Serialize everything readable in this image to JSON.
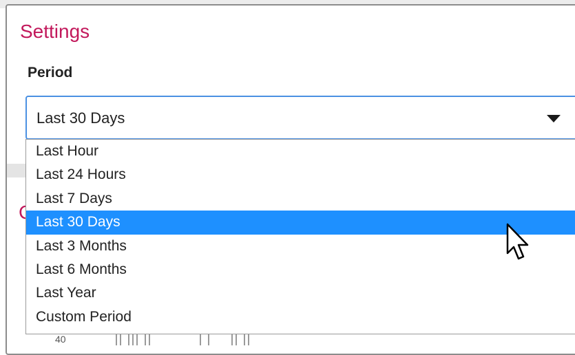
{
  "settings": {
    "title": "Settings",
    "period_label": "Period"
  },
  "period_select": {
    "value": "Last 30 Days",
    "options": [
      {
        "label": "Last Hour",
        "selected": false
      },
      {
        "label": "Last 24 Hours",
        "selected": false
      },
      {
        "label": "Last 7 Days",
        "selected": false
      },
      {
        "label": "Last 30 Days",
        "selected": true
      },
      {
        "label": "Last 3 Months",
        "selected": false
      },
      {
        "label": "Last 6 Months",
        "selected": false
      },
      {
        "label": "Last Year",
        "selected": false
      },
      {
        "label": "Custom Period",
        "selected": false
      }
    ]
  },
  "background": {
    "section_letter": "C",
    "axis_tick": "40"
  },
  "colors": {
    "title": "#c2185b",
    "select_border": "#4a90e2",
    "highlight": "#1e90ff"
  },
  "icons": {
    "dropdown_arrow": "caret-down-icon",
    "cursor": "mouse-pointer-icon"
  }
}
